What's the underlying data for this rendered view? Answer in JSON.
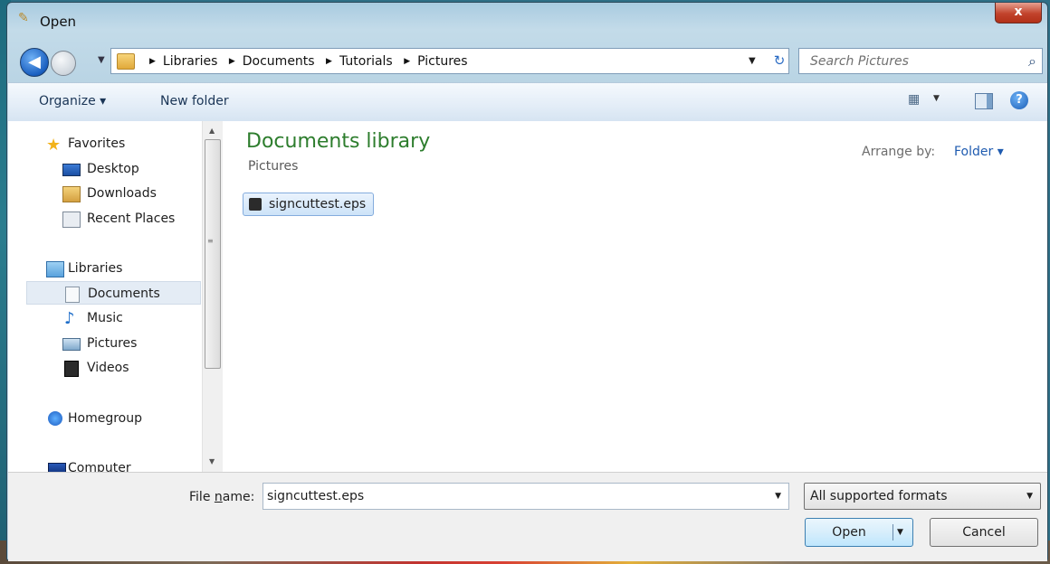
{
  "window": {
    "title": "Open",
    "close_glyph": "x"
  },
  "address": {
    "crumbs": [
      "Libraries",
      "Documents",
      "Tutorials",
      "Pictures"
    ],
    "search_placeholder": "Search Pictures"
  },
  "toolbar": {
    "organize": "Organize ▾",
    "new_folder": "New folder"
  },
  "nav": {
    "favorites": "Favorites",
    "desktop": "Desktop",
    "downloads": "Downloads",
    "recent": "Recent Places",
    "libraries": "Libraries",
    "documents": "Documents",
    "music": "Music",
    "pictures": "Pictures",
    "videos": "Videos",
    "homegroup": "Homegroup",
    "computer": "Computer"
  },
  "content": {
    "title": "Documents library",
    "subtitle": "Pictures",
    "arrange_label": "Arrange by:",
    "arrange_value": "Folder ▾",
    "files": [
      {
        "name": "signcuttest.eps",
        "selected": true
      }
    ]
  },
  "footer": {
    "file_name_label_pre": "File ",
    "file_name_label_u": "n",
    "file_name_label_post": "ame:",
    "file_name_value": "signcuttest.eps",
    "filter_value": "All supported formats",
    "open_label": "Open",
    "cancel_label": "Cancel"
  },
  "icons": {
    "back": "back-arrow-icon",
    "forward": "forward-arrow-icon",
    "search": "search-icon",
    "help": "help-icon",
    "views": "views-icon",
    "preview": "preview-pane-icon"
  },
  "colors": {
    "library_title": "#2d7d2d",
    "link": "#1f5bb0",
    "selection": "#cde3f8"
  }
}
